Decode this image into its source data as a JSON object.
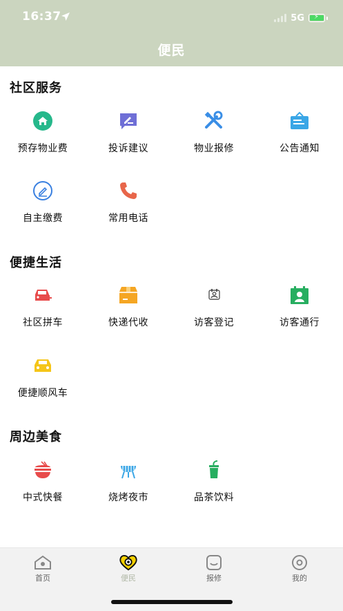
{
  "status_bar": {
    "time": "16:37",
    "network": "5G"
  },
  "header": {
    "title": "便民"
  },
  "sections": [
    {
      "title": "社区服务",
      "items": [
        {
          "label": "预存物业费",
          "icon": "home-circle-icon",
          "color": "#26b88b"
        },
        {
          "label": "投诉建议",
          "icon": "edit-note-icon",
          "color": "#6f6fd6"
        },
        {
          "label": "物业报修",
          "icon": "wrench-tools-icon",
          "color": "#3a8ee6"
        },
        {
          "label": "公告通知",
          "icon": "notice-board-icon",
          "color": "#3aa6e6"
        },
        {
          "label": "自主缴费",
          "icon": "pen-circle-icon",
          "color": "#3a80e0"
        },
        {
          "label": "常用电话",
          "icon": "phone-icon",
          "color": "#e8664a"
        }
      ]
    },
    {
      "title": "便捷生活",
      "items": [
        {
          "label": "社区拼车",
          "icon": "car-plus-icon",
          "color": "#e84b4b"
        },
        {
          "label": "快递代收",
          "icon": "package-box-icon",
          "color": "#f5a623"
        },
        {
          "label": "访客登记",
          "icon": "visitor-card-icon",
          "color": "#555555"
        },
        {
          "label": "访客通行",
          "icon": "visitor-pass-icon",
          "color": "#27ae60"
        },
        {
          "label": "便捷顺风车",
          "icon": "car-front-icon",
          "color": "#f5c518"
        }
      ]
    },
    {
      "title": "周边美食",
      "items": [
        {
          "label": "中式快餐",
          "icon": "rice-bowl-icon",
          "color": "#e84b4b"
        },
        {
          "label": "烧烤夜市",
          "icon": "grill-icon",
          "color": "#3aa6e6"
        },
        {
          "label": "品茶饮料",
          "icon": "drink-cup-icon",
          "color": "#27ae60"
        }
      ]
    }
  ],
  "tabbar": {
    "tabs": [
      {
        "label": "首页",
        "icon": "home-tab-icon"
      },
      {
        "label": "便民",
        "icon": "convenience-tab-icon",
        "active": true
      },
      {
        "label": "报修",
        "icon": "repair-tab-icon"
      },
      {
        "label": "我的",
        "icon": "profile-tab-icon"
      }
    ]
  }
}
